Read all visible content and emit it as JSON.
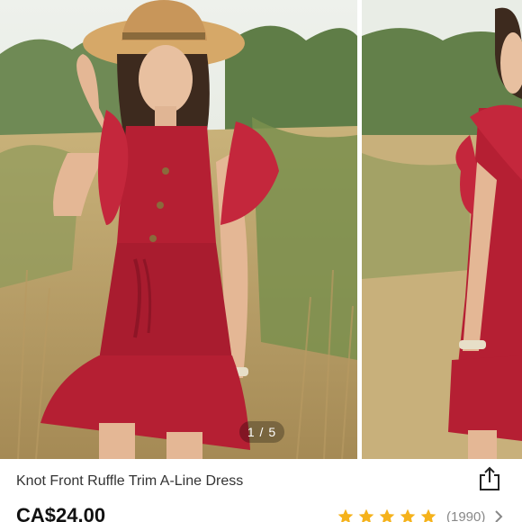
{
  "carousel": {
    "counter": "1 / 5",
    "slides": [
      {
        "name": "model in red ruffle dress front view"
      },
      {
        "name": "model in red ruffle dress side view"
      }
    ]
  },
  "product": {
    "title": "Knot Front Ruffle Trim A-Line Dress",
    "price": "CA$24.00",
    "rating_stars": 5,
    "review_count": "(1990)"
  },
  "icons": {
    "share": "share-icon",
    "star": "star-icon",
    "chevron": "chevron-right-icon"
  },
  "colors": {
    "dress": "#b51f33",
    "star": "#f5b21b",
    "text": "#333333"
  }
}
